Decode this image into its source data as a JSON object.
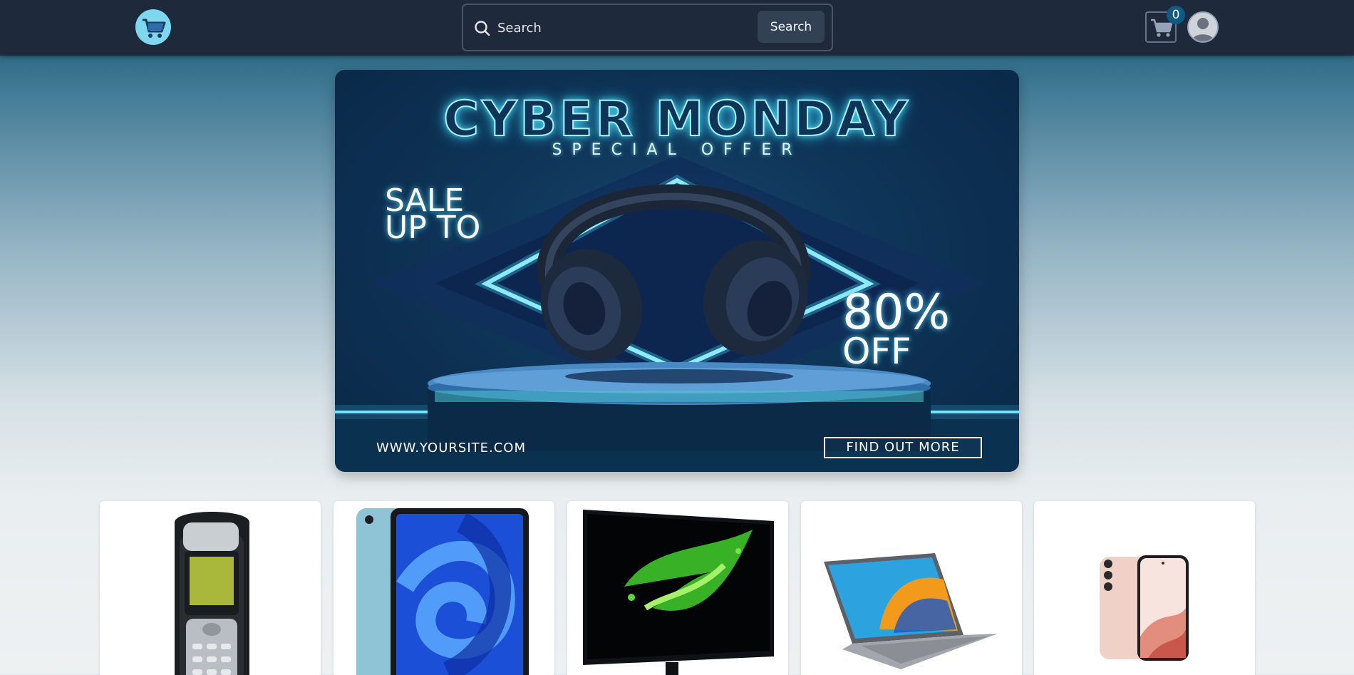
{
  "navbar": {
    "logo_icon": "shopping-cart-logo",
    "search": {
      "placeholder": "Search",
      "button_label": "Search",
      "icon": "search-icon"
    },
    "cart": {
      "icon": "cart-icon",
      "count": "0"
    },
    "account": {
      "icon": "user-avatar-icon"
    }
  },
  "banner": {
    "title": "CYBER MONDAY",
    "subtitle": "SPECIAL OFFER",
    "sale_line1": "SALE",
    "sale_line2": "UP TO",
    "discount": "80%",
    "discount_suffix": "OFF",
    "website": "WWW.YOURSITE.COM",
    "cta_label": "FIND OUT MORE"
  },
  "products": [
    {
      "image": "nokia-phone-image"
    },
    {
      "image": "ipad-tablet-image"
    },
    {
      "image": "acer-monitor-image"
    },
    {
      "image": "laptop-image"
    },
    {
      "image": "galaxy-phone-image"
    }
  ],
  "colors": {
    "navbar_bg": "#1e293b",
    "search_button_bg": "#334155",
    "badge_bg": "#0e5b84",
    "banner_bg": "#0e3457",
    "neon_accent": "#4fd2f0"
  }
}
